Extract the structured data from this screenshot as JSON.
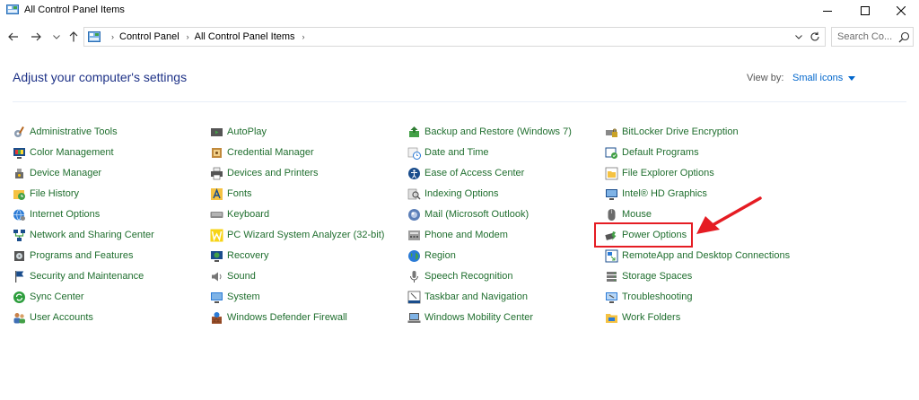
{
  "window": {
    "title": "All Control Panel Items",
    "controls": [
      "minimize-icon",
      "maximize-icon",
      "close-icon"
    ]
  },
  "address": {
    "crumbs": [
      "Control Panel",
      "All Control Panel Items"
    ],
    "search_placeholder": "Search Co...",
    "icons": [
      "back-arrow-icon",
      "forward-arrow-icon",
      "recent-chevron-icon",
      "up-arrow-icon",
      "address-dropdown-icon",
      "refresh-icon",
      "search-icon"
    ]
  },
  "header": {
    "title": "Adjust your computer's settings",
    "view_by_label": "View by:",
    "view_by_value": "Small icons"
  },
  "columns": [
    [
      "Administrative Tools",
      "Color Management",
      "Device Manager",
      "File History",
      "Internet Options",
      "Network and Sharing Center",
      "Programs and Features",
      "Security and Maintenance",
      "Sync Center",
      "User Accounts"
    ],
    [
      "AutoPlay",
      "Credential Manager",
      "Devices and Printers",
      "Fonts",
      "Keyboard",
      "PC Wizard System Analyzer (32-bit)",
      "Recovery",
      "Sound",
      "System",
      "Windows Defender Firewall"
    ],
    [
      "Backup and Restore (Windows 7)",
      "Date and Time",
      "Ease of Access Center",
      "Indexing Options",
      "Mail (Microsoft Outlook)",
      "Phone and Modem",
      "Region",
      "Speech Recognition",
      "Taskbar and Navigation",
      "Windows Mobility Center"
    ],
    [
      "BitLocker Drive Encryption",
      "Default Programs",
      "File Explorer Options",
      "Intel® HD Graphics",
      "Mouse",
      "Power Options",
      "RemoteApp and Desktop Connections",
      "Storage Spaces",
      "Troubleshooting",
      "Work Folders"
    ]
  ],
  "annotation": {
    "highlighted_item": "Power Options",
    "color": "#e51c23"
  },
  "colors": {
    "item_text": "#1f6e2e",
    "heading": "#1e3287",
    "link": "#0066cc"
  }
}
